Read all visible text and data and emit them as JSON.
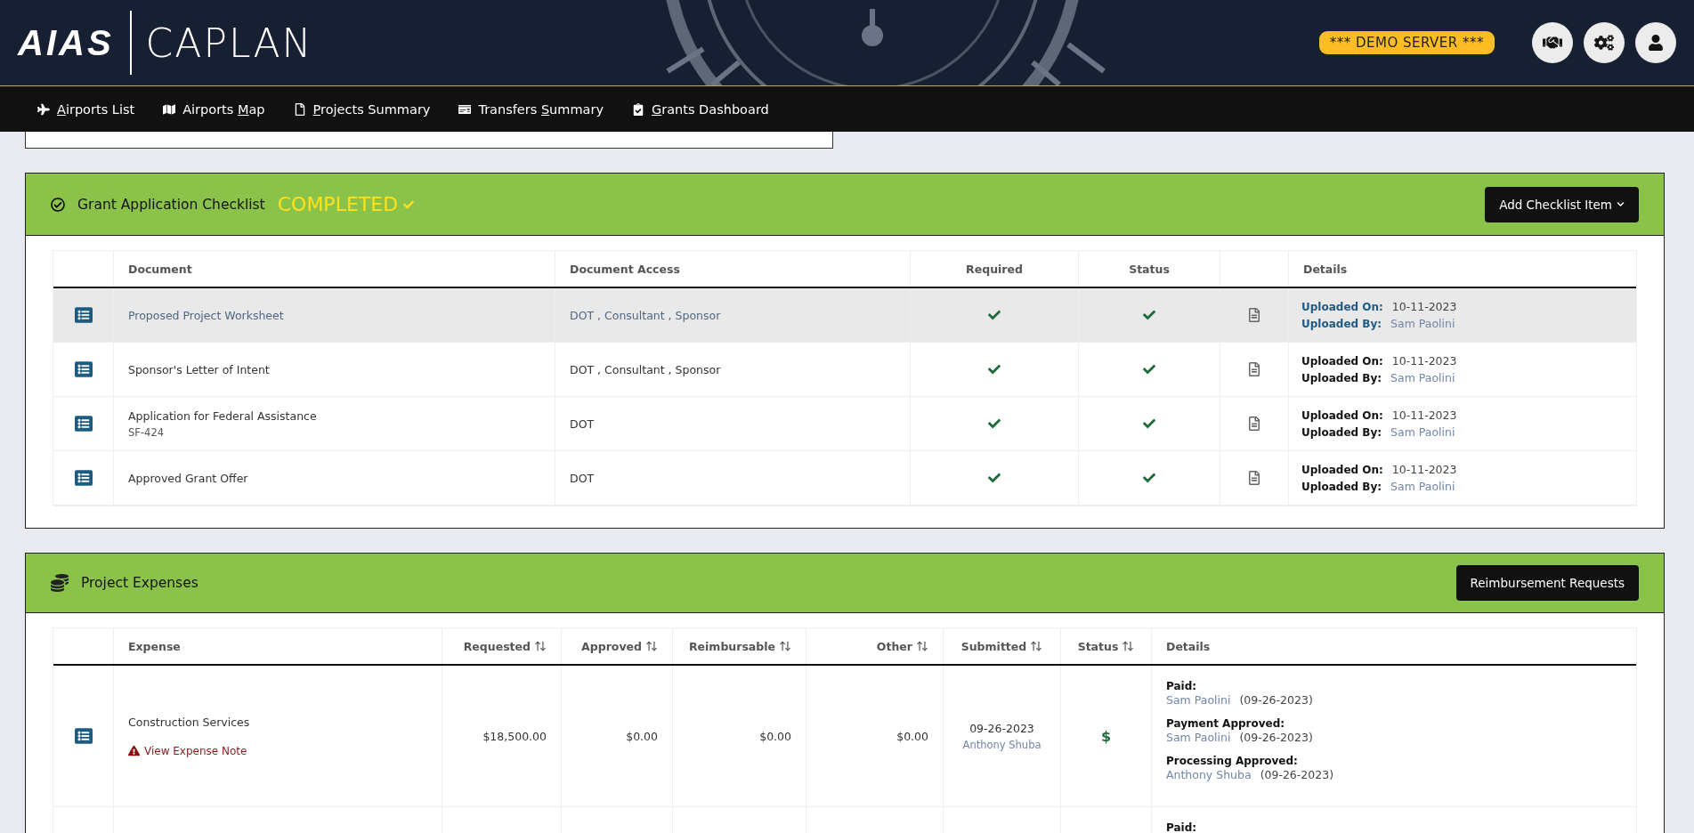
{
  "header": {
    "logo": "AIAS",
    "app_name": "CAPLAN",
    "server_badge": "*** DEMO SERVER ***"
  },
  "nav": [
    {
      "kind": "plane",
      "key": "A",
      "post": "irports List"
    },
    {
      "kind": "map",
      "pre": "Airports ",
      "key": "M",
      "post": "ap"
    },
    {
      "kind": "file",
      "key": "P",
      "post": "rojects Summary"
    },
    {
      "kind": "money",
      "pre": "Transfers ",
      "key": "S",
      "post": "ummary"
    },
    {
      "kind": "clipboard",
      "key": "G",
      "post": "rants Dashboard"
    }
  ],
  "checklist": {
    "title": "Grant Application Checklist",
    "status": "COMPLETED",
    "button": "Add Checklist Item",
    "columns": [
      "Document",
      "Document Access",
      "Required",
      "Status",
      "Details"
    ],
    "rows": [
      {
        "selected": true,
        "document": "Proposed Project Worksheet",
        "access": "DOT , Consultant , Sponsor",
        "required": true,
        "done": true,
        "details": [
          {
            "kind": "date",
            "label": "Uploaded On:",
            "value": "10-11-2023"
          },
          {
            "kind": "person",
            "label": "Uploaded By:",
            "value": "Sam Paolini"
          }
        ]
      },
      {
        "selected": false,
        "document": "Sponsor's Letter of Intent",
        "access": "DOT , Consultant , Sponsor",
        "required": true,
        "done": true,
        "details": [
          {
            "kind": "date",
            "label": "Uploaded On:",
            "value": "10-11-2023"
          },
          {
            "kind": "person",
            "label": "Uploaded By:",
            "value": "Sam Paolini"
          }
        ]
      },
      {
        "selected": false,
        "document": "Application for Federal Assistance",
        "subtitle": "SF-424",
        "access": "DOT",
        "required": true,
        "done": true,
        "details": [
          {
            "kind": "date",
            "label": "Uploaded On:",
            "value": "10-11-2023"
          },
          {
            "kind": "person",
            "label": "Uploaded By:",
            "value": "Sam Paolini"
          }
        ]
      },
      {
        "selected": false,
        "document": "Approved Grant Offer",
        "access": "DOT",
        "required": true,
        "done": true,
        "details": [
          {
            "kind": "date",
            "label": "Uploaded On:",
            "value": "10-11-2023"
          },
          {
            "kind": "person",
            "label": "Uploaded By:",
            "value": "Sam Paolini"
          }
        ]
      }
    ]
  },
  "expenses": {
    "title": "Project Expenses",
    "button": "Reimbursement Requests",
    "columns": [
      "Expense",
      "Requested",
      "Approved",
      "Reimbursable",
      "Other",
      "Submitted",
      "Status",
      "Details"
    ],
    "rows": [
      {
        "expense": "Construction Services",
        "note": "View Expense Note",
        "requested": "$18,500.00",
        "approved": "$0.00",
        "reimbursable": "$0.00",
        "other": "$0.00",
        "submitted_date": "09-26-2023",
        "submitted_by": "Anthony Shuba",
        "status": "$",
        "details": [
          {
            "label": "Paid:",
            "name": "Sam Paolini",
            "date": "(09-26-2023)"
          },
          {
            "label": "Payment Approved:",
            "name": "Sam Paolini",
            "date": "(09-26-2023)"
          },
          {
            "label": "Processing Approved:",
            "name": "Anthony Shuba",
            "date": "(09-26-2023)"
          }
        ]
      },
      {
        "details": [
          {
            "label": "Paid:"
          }
        ]
      }
    ]
  }
}
